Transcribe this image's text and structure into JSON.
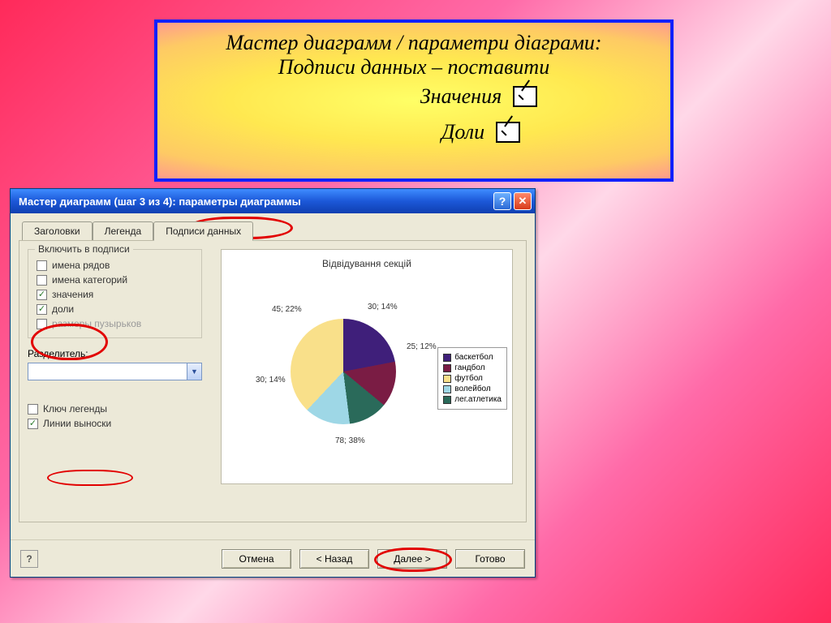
{
  "instruction": {
    "line1": "Мастер диаграмм / параметри діаграми:",
    "line2": "Подписи данных – поставити",
    "opt1": "Значения",
    "opt2": "Доли"
  },
  "dialog": {
    "title": "Мастер диаграмм (шаг 3 из 4): параметры диаграммы",
    "tabs": {
      "t1": "Заголовки",
      "t2": "Легенда",
      "t3": "Подписи данных"
    },
    "group_legend": "Включить в подписи",
    "checks": {
      "series": "имена рядов",
      "categories": "имена категорий",
      "values": "значения",
      "percents": "доли",
      "bubbles": "размеры пузырьков"
    },
    "separator_label": "Разделитель:",
    "key_legend": "Ключ легенды",
    "leader_lines": "Линии выноски",
    "buttons": {
      "cancel": "Отмена",
      "back": "< Назад",
      "next": "Далее >",
      "finish": "Готово",
      "help": "?"
    },
    "preview_title": "Відвідування секцій",
    "slice_labels": {
      "a": "45; 22%",
      "b": "30; 14%",
      "c": "25; 12%",
      "d": "30; 14%",
      "e": "78; 38%"
    },
    "legend_items": {
      "l1": "баскетбол",
      "l2": "гандбол",
      "l3": "футбол",
      "l4": "волейбол",
      "l5": "лег.атлетика"
    },
    "colors": {
      "l1": "#3f1f7a",
      "l2": "#7a1c44",
      "l3": "#f9e08a",
      "l4": "#9ed7e6",
      "l5": "#2a6a5a"
    }
  },
  "chart_data": {
    "type": "pie",
    "title": "Відвідування секцій",
    "categories": [
      "баскетбол",
      "гандбол",
      "футбол",
      "волейбол",
      "лег.атлетика"
    ],
    "values": [
      30,
      25,
      78,
      30,
      45
    ],
    "percents": [
      14,
      12,
      38,
      14,
      22
    ],
    "labels": [
      "30; 14%",
      "25; 12%",
      "78; 38%",
      "30; 14%",
      "45; 22%"
    ]
  }
}
